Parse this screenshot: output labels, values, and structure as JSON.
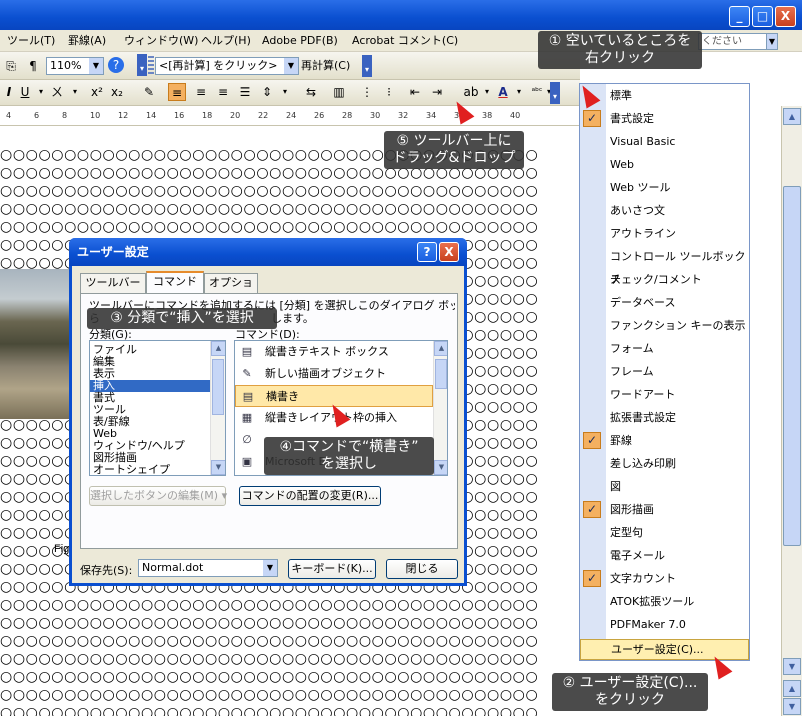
{
  "window": {
    "minimize_label": "_",
    "maximize_label": "□",
    "close_label": "X"
  },
  "menubar": {
    "items": [
      "ツール(T)",
      "罫線(A)",
      "ウィンドウ(W)",
      "ヘルプ(H)",
      "Adobe PDF(B)",
      "Acrobat コメント(C)"
    ],
    "help_placeholder": "ください"
  },
  "toolbar1": {
    "zoom": "110%",
    "reset_combo": "<[再計算] をクリック>",
    "recalc_button": "再計算(C)"
  },
  "ruler": {
    "ticks": [
      "4",
      "6",
      "8",
      "10",
      "12",
      "14",
      "16",
      "18",
      "20",
      "22",
      "24",
      "26",
      "28",
      "30",
      "32",
      "34",
      "36",
      "38",
      "40"
    ]
  },
  "document": {
    "circle_row": "○○○○○○○○○○○○○○○○○○○○○○○○○○○○○○○○○○○○○○○○○○",
    "fig_label": "Fig"
  },
  "context_menu": {
    "items": [
      {
        "label": "標準",
        "checked": false
      },
      {
        "label": "書式設定",
        "checked": true
      },
      {
        "label": "Visual Basic",
        "checked": false
      },
      {
        "label": "Web",
        "checked": false
      },
      {
        "label": "Web ツール",
        "checked": false
      },
      {
        "label": "あいさつ文",
        "checked": false
      },
      {
        "label": "アウトライン",
        "checked": false
      },
      {
        "label": "コントロール ツールボックス",
        "checked": false
      },
      {
        "label": "チェック/コメント",
        "checked": false
      },
      {
        "label": "データベース",
        "checked": false
      },
      {
        "label": "ファンクション キーの表示",
        "checked": false
      },
      {
        "label": "フォーム",
        "checked": false
      },
      {
        "label": "フレーム",
        "checked": false
      },
      {
        "label": "ワードアート",
        "checked": false
      },
      {
        "label": "拡張書式設定",
        "checked": false
      },
      {
        "label": "罫線",
        "checked": true
      },
      {
        "label": "差し込み印刷",
        "checked": false
      },
      {
        "label": "図",
        "checked": false
      },
      {
        "label": "図形描画",
        "checked": true
      },
      {
        "label": "定型句",
        "checked": false
      },
      {
        "label": "電子メール",
        "checked": false
      },
      {
        "label": "文字カウント",
        "checked": true
      },
      {
        "label": "ATOK拡張ツール",
        "checked": false
      },
      {
        "label": "PDFMaker 7.0",
        "checked": false
      }
    ],
    "user_settings": "ユーザー設定(C)..."
  },
  "dialog": {
    "title": "ユーザー設定",
    "help_label": "?",
    "close_label": "X",
    "tabs": [
      "ツールバー",
      "コマンド",
      "オプション"
    ],
    "description": "ツールバーにコマンドを追加するには [分類] を選択しこのダイアログ ボックスか",
    "description2": "ら",
    "description3": "します。",
    "category_label": "分類(G):",
    "command_label": "コマンド(D):",
    "categories": [
      "ファイル",
      "編集",
      "表示",
      "挿入",
      "書式",
      "ツール",
      "表/罫線",
      "Web",
      "ウィンドウ/ヘルプ",
      "図形描画",
      "オートシェイプ"
    ],
    "selected_category": "挿入",
    "commands": [
      {
        "icon": "▤",
        "label": "縦書きテキスト ボックス"
      },
      {
        "icon": "✎",
        "label": "新しい描画オブジェクト"
      },
      {
        "icon": "▤",
        "label": "横書き"
      },
      {
        "icon": "▦",
        "label": "縦書きレイアウト枠の挿入"
      },
      {
        "icon": "∅",
        "label": ""
      },
      {
        "icon": "▣",
        "label": "Microsoft E"
      },
      {
        "icon": "",
        "label": "ートの挿"
      }
    ],
    "edit_button": "選択したボタンの編集(M) ▾",
    "rearrange_button": "コマンドの配置の変更(R)...",
    "save_label": "保存先(S):",
    "save_value": "Normal.dot",
    "keyboard_button": "キーボード(K)...",
    "close_button": "閉じる"
  },
  "callouts": {
    "c1_line1": "① 空いているところを",
    "c1_line2": "右クリック",
    "c2_line1": "② ユーザー設定(C)...",
    "c2_line2": "をクリック",
    "c3": "③ 分類で“挿入”を選択",
    "c4_line1": "④コマンドで“横書き”",
    "c4_line2": "を選択し",
    "c5_line1": "⑤ ツールバー上に",
    "c5_line2": "ドラッグ&ドロップ"
  },
  "colors": {
    "titlebar": "#0a4fd0",
    "check_orange": "#f4b060",
    "highlight": "#ffefb0",
    "selection": "#316ac5"
  }
}
